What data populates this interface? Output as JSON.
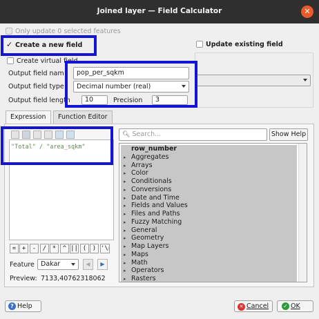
{
  "window": {
    "title": "Joined layer — Field Calculator"
  },
  "top": {
    "only_update_label": "Only update 0 selected features",
    "create_new_label": "Create a new field",
    "create_new_check": "✓",
    "update_existing_label": "Update existing field",
    "create_virtual_label": "Create virtual field"
  },
  "fields": {
    "output_name_label": "Output field nam",
    "output_name_value": "pop_per_sqkm",
    "output_type_label": "Output field type",
    "output_type_value": "Decimal number (real)",
    "output_length_label": "Output field length",
    "output_length_value": "10",
    "precision_label": "Precision",
    "precision_value": "3"
  },
  "tabs": [
    {
      "label": "Expression"
    },
    {
      "label": "Function Editor"
    }
  ],
  "expression": {
    "text": "\"Total\" / \"area_sqkm\""
  },
  "search": {
    "placeholder": "Search...",
    "show_help": "Show Help"
  },
  "tree": {
    "items": [
      {
        "label": "row_number",
        "arrow": ""
      },
      {
        "label": "Aggregates",
        "arrow": "▸"
      },
      {
        "label": "Arrays",
        "arrow": "▸"
      },
      {
        "label": "Color",
        "arrow": "▸"
      },
      {
        "label": "Conditionals",
        "arrow": "▸"
      },
      {
        "label": "Conversions",
        "arrow": "▸"
      },
      {
        "label": "Date and Time",
        "arrow": "▸"
      },
      {
        "label": "Fields and Values",
        "arrow": "▸"
      },
      {
        "label": "Files and Paths",
        "arrow": "▸"
      },
      {
        "label": "Fuzzy Matching",
        "arrow": "▸"
      },
      {
        "label": "General",
        "arrow": "▸"
      },
      {
        "label": "Geometry",
        "arrow": "▸"
      },
      {
        "label": "Map Layers",
        "arrow": "▸"
      },
      {
        "label": "Maps",
        "arrow": "▸"
      },
      {
        "label": "Math",
        "arrow": "▸"
      },
      {
        "label": "Operators",
        "arrow": "▸"
      },
      {
        "label": "Rasters",
        "arrow": "▸"
      }
    ]
  },
  "operators": [
    "=",
    "+",
    "-",
    "/",
    "*",
    "^",
    "||",
    "(",
    ")",
    "'\\n'"
  ],
  "feature": {
    "label": "Feature",
    "value": "Dakar",
    "prev": "◀",
    "next": "▶"
  },
  "preview": {
    "label": "Preview:",
    "value": "7133,40762318062"
  },
  "buttons": {
    "help": "Help",
    "help_icon": "?",
    "cancel": "Cancel",
    "cancel_icon": "✕",
    "ok": "OK",
    "ok_icon": "✓"
  },
  "colors": {
    "highlight": "#1414d6",
    "titlebar": "#2f2f2f",
    "close": "#ea5a2a"
  }
}
